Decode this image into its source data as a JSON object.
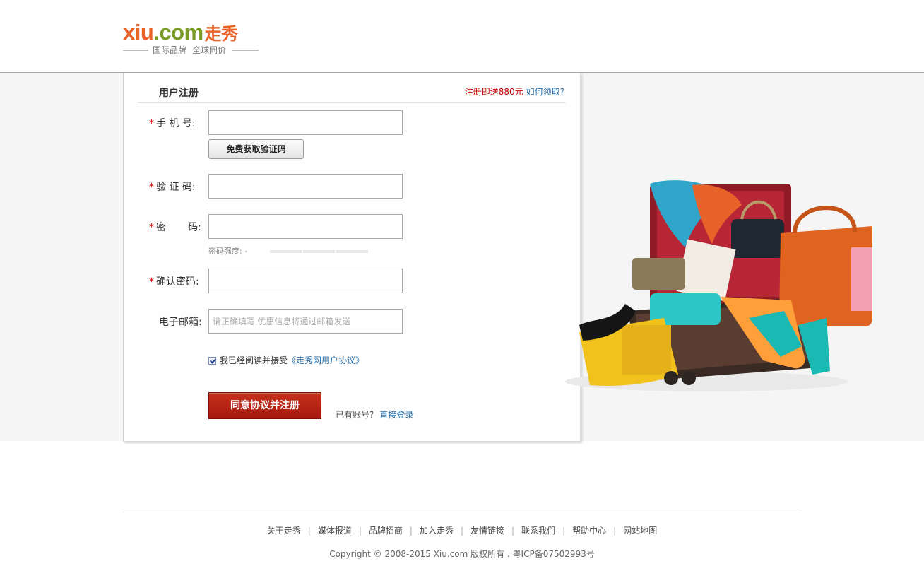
{
  "header": {
    "logo_xiu": "xiu",
    "logo_com": ".com",
    "logo_cn": "走秀",
    "slogan_1": "国际品牌",
    "slogan_2": "全球同价"
  },
  "form": {
    "title": "用户注册",
    "promo_text": "注册即送880元",
    "promo_link": "如何领取?",
    "phone_label": "手 机 号:",
    "get_code_button": "免费获取验证码",
    "code_label": "验 证 码:",
    "password_label": "密       码:",
    "password_strength": "密码强度: -",
    "confirm_label": "确认密码:",
    "email_label": "电子邮箱:",
    "email_placeholder": "请正确填写,优惠信息将通过邮箱发送",
    "agree_text": "我已经阅读并接受",
    "agree_link": "《走秀网用户协议》",
    "submit_button": "同意协议并注册",
    "has_account": "已有账号?",
    "login_link": "直接登录",
    "required_mark": "*"
  },
  "footer": {
    "links": [
      "关于走秀",
      "媒体报道",
      "品牌招商",
      "加入走秀",
      "友情链接",
      "联系我们",
      "帮助中心",
      "网站地图"
    ],
    "copyright": "Copyright © 2008-2015 Xiu.com 版权所有 . 粤ICP备07502993号"
  },
  "colors": {
    "brand_orange": "#e8632a",
    "brand_green": "#7a9b26",
    "submit_red": "#b5200f",
    "link_blue": "#2a6fa8"
  }
}
